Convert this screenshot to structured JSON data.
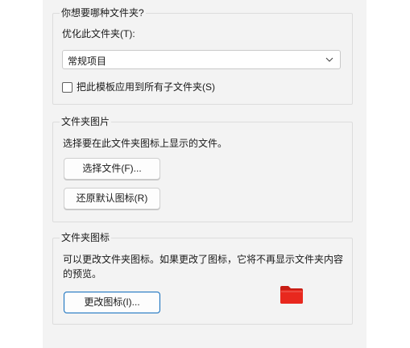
{
  "view_type": {
    "legend": "你想要哪种文件夹?",
    "optimize_label": "优化此文件夹(T):",
    "optimize_value": "常规项目",
    "apply_all_label": "把此模板应用到所有子文件夹(S)",
    "apply_all_checked": false
  },
  "folder_pictures": {
    "legend": "文件夹图片",
    "description": "选择要在此文件夹图标上显示的文件。",
    "choose_file_label": "选择文件(F)...",
    "restore_default_label": "还原默认图标(R)"
  },
  "folder_icons": {
    "legend": "文件夹图标",
    "description_line1": "可以更改文件夹图标。如果更改了图标，它将不再显示文件夹内容",
    "description_line2": "的预览。",
    "change_icon_label": "更改图标(I)...",
    "icon_name": "folder-icon",
    "icon_color": "#e8281e"
  },
  "colors": {
    "panel_bg": "#f3f3f3",
    "accent": "#0f6cbd"
  }
}
